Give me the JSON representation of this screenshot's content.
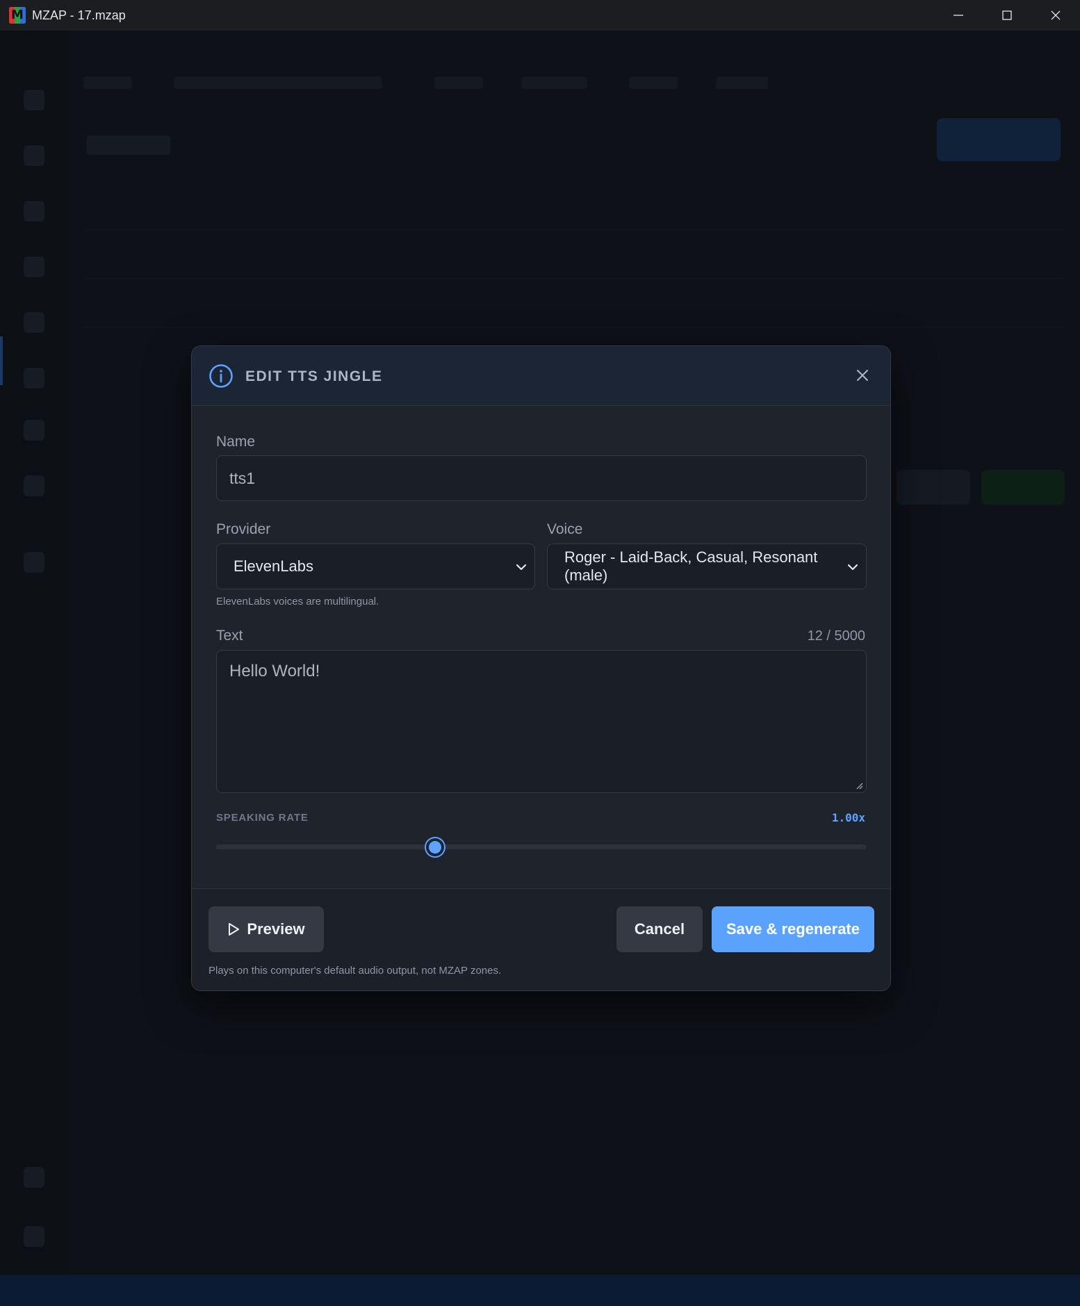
{
  "window": {
    "title": "MZAP - 17.mzap",
    "logo_letter": "M"
  },
  "dialog": {
    "title": "EDIT TTS JINGLE",
    "name": {
      "label": "Name",
      "value": "tts1"
    },
    "provider": {
      "label": "Provider",
      "selected": "ElevenLabs",
      "hint": "ElevenLabs voices are multilingual."
    },
    "voice": {
      "label": "Voice",
      "selected": "Roger - Laid-Back, Casual, Resonant (male)"
    },
    "text": {
      "label": "Text",
      "counter": "12 / 5000",
      "value": "Hello World!"
    },
    "speaking_rate": {
      "label": "SPEAKING RATE",
      "display": "1.00x",
      "value": 1.0,
      "slider_fraction": 0.337
    },
    "buttons": {
      "preview": "Preview",
      "cancel": "Cancel",
      "save": "Save & regenerate"
    },
    "footer_hint": "Plays on this computer's default audio output, not MZAP zones."
  },
  "colors": {
    "accent": "#5aa2fb",
    "modal_bg": "#1f232c",
    "header_bg": "#1c2535",
    "button_secondary": "#343944"
  }
}
